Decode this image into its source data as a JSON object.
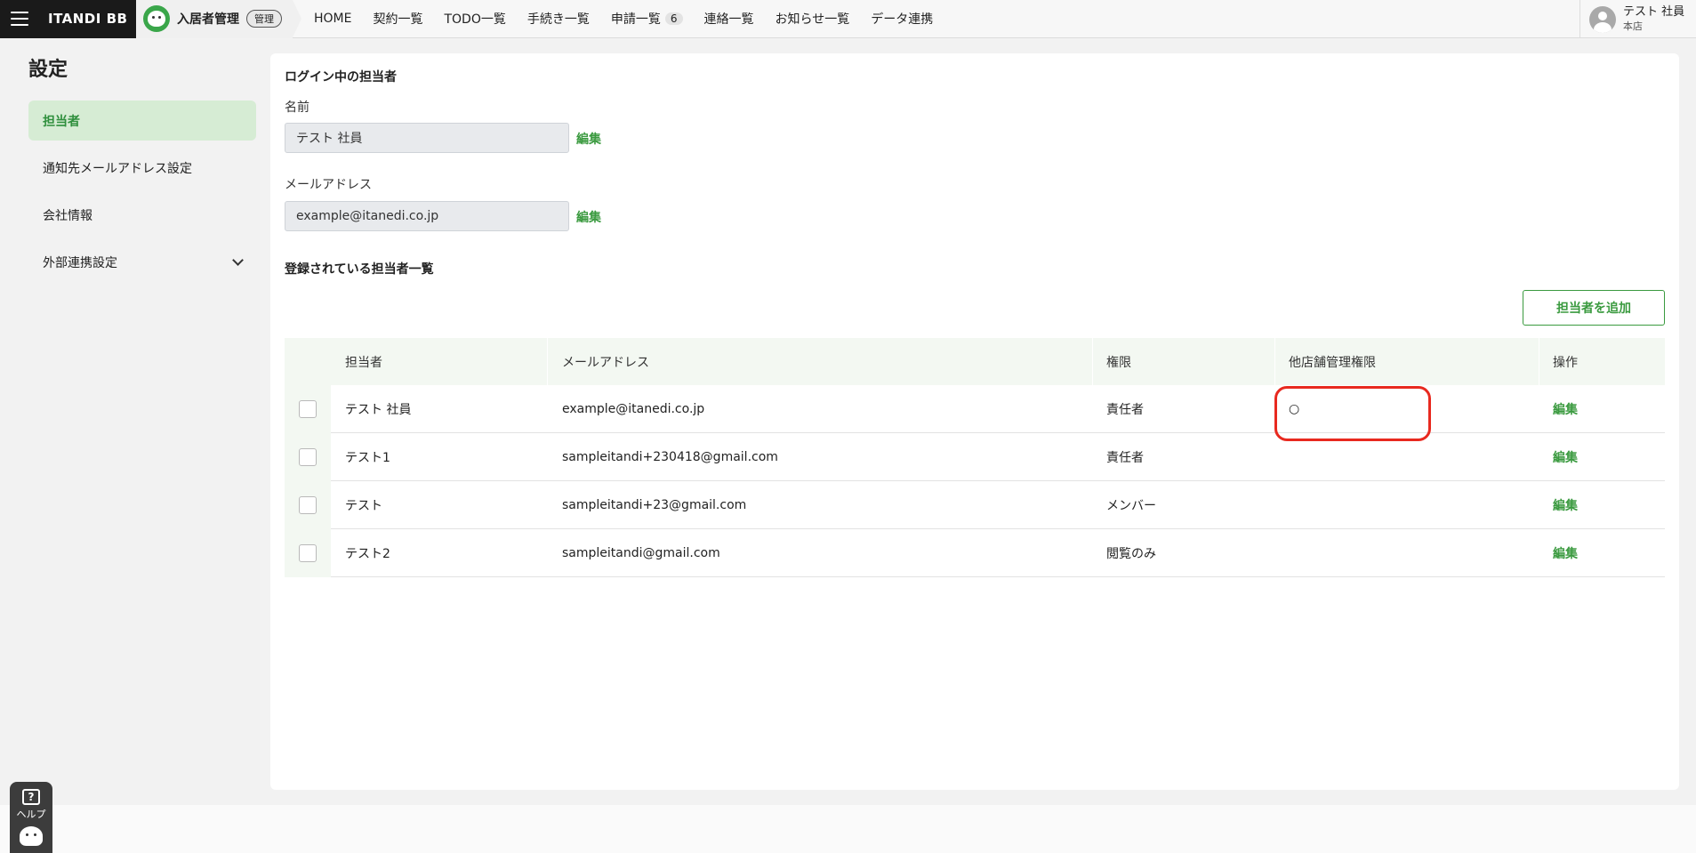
{
  "topbar": {
    "brand": "ITANDI BB",
    "app_name": "入居者管理",
    "app_badge": "管理",
    "nav": [
      {
        "label": "HOME"
      },
      {
        "label": "契約一覧"
      },
      {
        "label": "TODO一覧"
      },
      {
        "label": "手続き一覧"
      },
      {
        "label": "申請一覧",
        "count": "6"
      },
      {
        "label": "連絡一覧"
      },
      {
        "label": "お知らせ一覧"
      },
      {
        "label": "データ連携"
      }
    ],
    "user": {
      "name": "テスト 社員",
      "store": "本店"
    }
  },
  "sidebar": {
    "title": "設定",
    "items": [
      {
        "label": "担当者"
      },
      {
        "label": "通知先メールアドレス設定"
      },
      {
        "label": "会社情報"
      },
      {
        "label": "外部連携設定"
      }
    ]
  },
  "main": {
    "login_section_title": "ログイン中の担当者",
    "name_label": "名前",
    "name_value": "テスト 社員",
    "email_label": "メールアドレス",
    "email_value": "example@itanedi.co.jp",
    "edit_label": "編集",
    "list_title": "登録されている担当者一覧",
    "add_button": "担当者を追加",
    "table": {
      "headers": [
        "担当者",
        "メールアドレス",
        "権限",
        "他店舗管理権限",
        "操作"
      ],
      "rows": [
        {
          "name": "テスト 社員",
          "email": "example@itanedi.co.jp",
          "role": "責任者",
          "other_store": "○",
          "action": "編集"
        },
        {
          "name": "テスト1",
          "email": "sampleitandi+230418@gmail.com",
          "role": "責任者",
          "other_store": "",
          "action": "編集"
        },
        {
          "name": "テスト",
          "email": "sampleitandi+23@gmail.com",
          "role": "メンバー",
          "other_store": "",
          "action": "編集"
        },
        {
          "name": "テスト2",
          "email": "sampleitandi@gmail.com",
          "role": "閲覧のみ",
          "other_store": "",
          "action": "編集"
        }
      ]
    }
  },
  "help": {
    "label": "ヘルプ",
    "icon": "?"
  },
  "colors": {
    "accent": "#3a9a3f",
    "highlight": "#e8291f",
    "active_bg": "#d6ecd4"
  }
}
